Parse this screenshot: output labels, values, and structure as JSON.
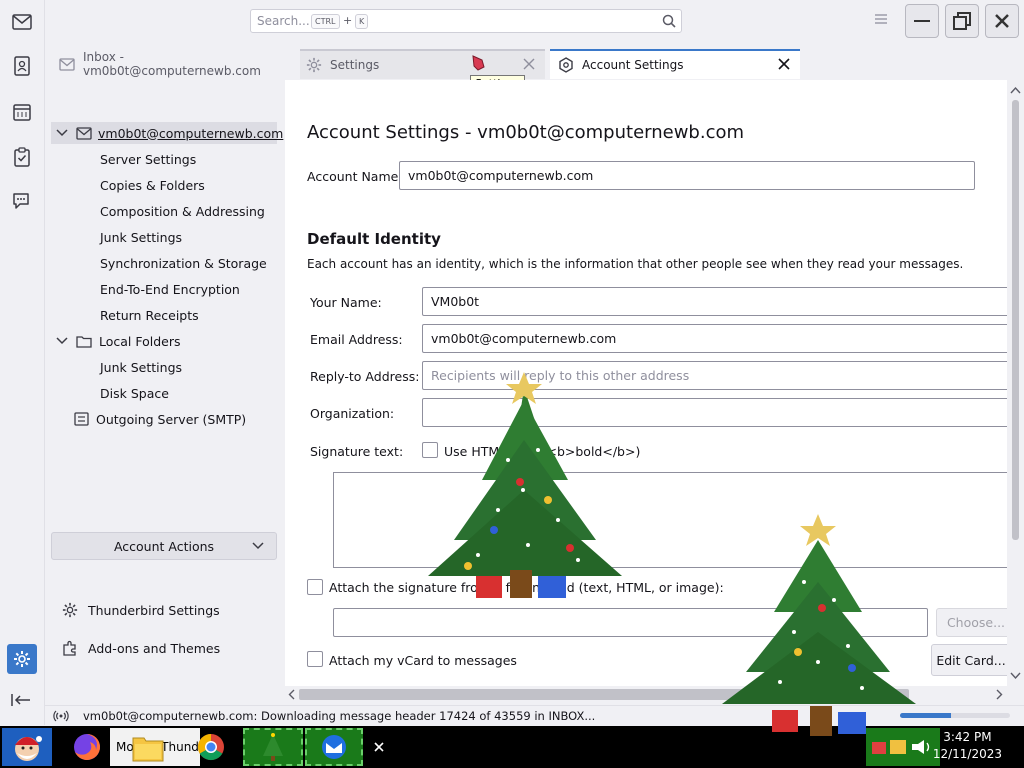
{
  "topbar": {
    "search_placeholder": "Search...",
    "search_key1": "CTRL",
    "search_plus": "+",
    "search_key2": "K"
  },
  "tabs": [
    {
      "label": "Inbox - vm0b0t@computernewb.com"
    },
    {
      "label": "Settings"
    },
    {
      "label": "Account Settings"
    }
  ],
  "tooltip": "Settings",
  "tree": {
    "account": "vm0b0t@computernewb.com",
    "account_children": [
      "Server Settings",
      "Copies & Folders",
      "Composition & Addressing",
      "Junk Settings",
      "Synchronization & Storage",
      "End-To-End Encryption",
      "Return Receipts"
    ],
    "local_folders": "Local Folders",
    "local_children": [
      "Junk Settings",
      "Disk Space"
    ],
    "outgoing": "Outgoing Server (SMTP)",
    "account_actions": "Account Actions",
    "thunderbird_settings": "Thunderbird Settings",
    "addons": "Add-ons and Themes"
  },
  "main": {
    "title": "Account Settings - vm0b0t@computernewb.com",
    "account_name_label": "Account Name:",
    "account_name_value": "vm0b0t@computernewb.com",
    "section_title": "Default Identity",
    "section_desc": "Each account has an identity, which is the information that other people see when they read your messages.",
    "your_name_label": "Your Name:",
    "your_name_value": "VM0b0t",
    "email_label": "Email Address:",
    "email_value": "vm0b0t@computernewb.com",
    "reply_label": "Reply-to Address:",
    "reply_placeholder": "Recipients will reply to this other address",
    "org_label": "Organization:",
    "org_value": "",
    "sig_label": "Signature text:",
    "use_html_label": "Use HTML (e.g., <b>bold</b>)",
    "attach_sig_label": "Attach the signature from a file instead (text, HTML, or image):",
    "choose_btn": "Choose...",
    "attach_vcard_label": "Attach my vCard to messages",
    "edit_card_btn": "Edit Card..."
  },
  "status": {
    "text": "vm0b0t@computernewb.com: Downloading message header 17424 of 43559 in INBOX...",
    "progress": 0.46
  },
  "taskbar": {
    "app_label": "Mozilla Thunderbird",
    "time": "3:42 PM",
    "date": "12/11/2023"
  },
  "colors": {
    "accent": "#3a78c9",
    "background": "#f0f0f4",
    "taskbar": "#000000"
  }
}
